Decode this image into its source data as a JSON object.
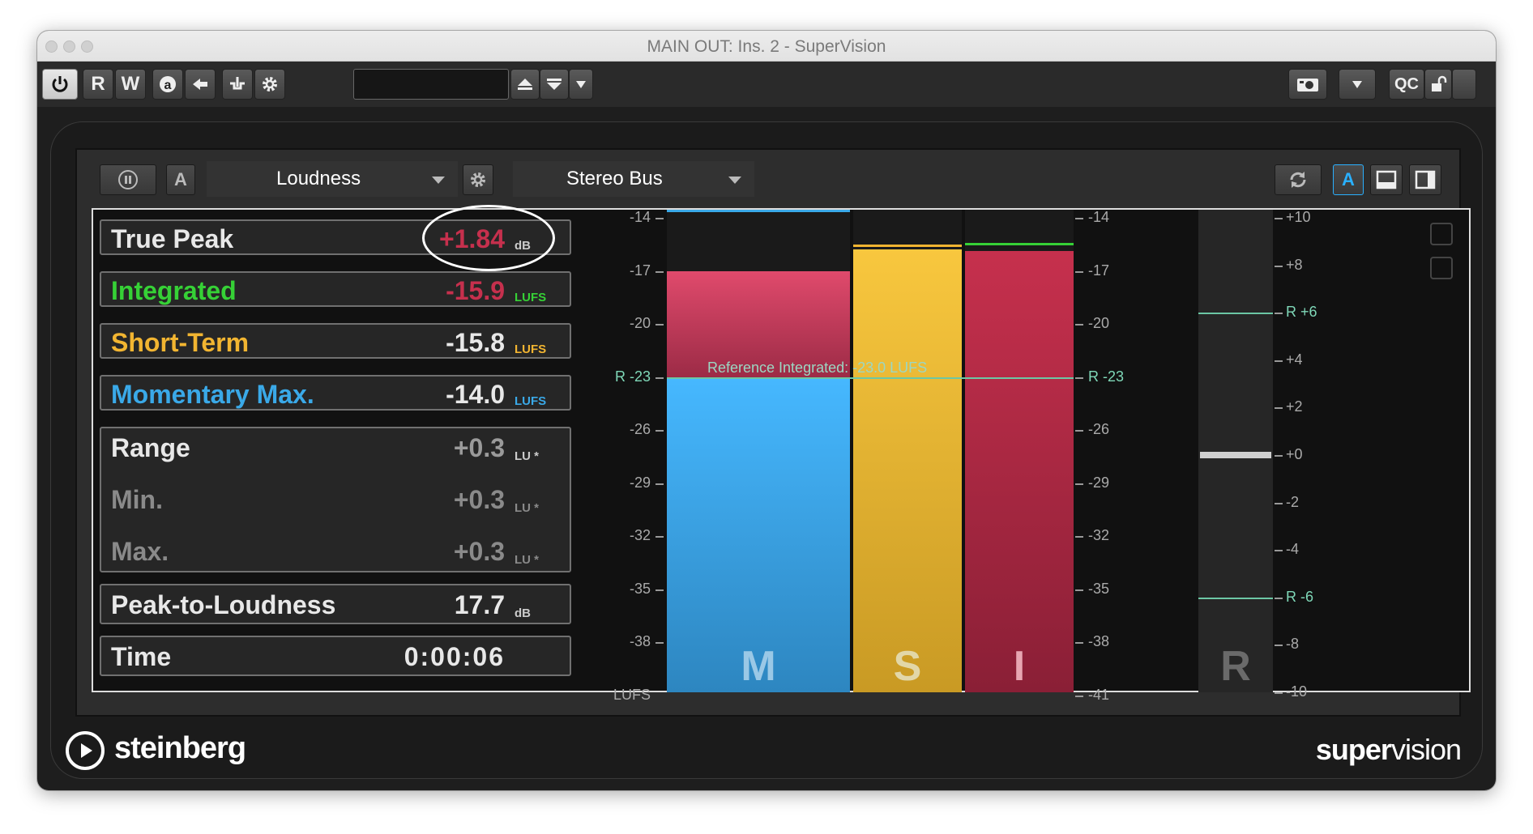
{
  "window": {
    "title": "MAIN OUT: Ins. 2 - SuperVision"
  },
  "toolbar": {
    "r": "R",
    "w": "W",
    "qc": "QC",
    "icons": [
      "power-icon",
      "read-button",
      "write-button",
      "auto-icon",
      "arrow-left-icon",
      "sidechain-icon",
      "gear-icon",
      "camera-icon",
      "lock-icon"
    ]
  },
  "header": {
    "module": "Loudness",
    "channel": "Stereo Bus",
    "a_label": "A",
    "a_right": "A"
  },
  "rows": {
    "true_peak": {
      "label": "True Peak",
      "value": "+1.84",
      "unit": "dB"
    },
    "integrated": {
      "label": "Integrated",
      "value": "-15.9",
      "unit": "LUFS"
    },
    "short_term": {
      "label": "Short-Term",
      "value": "-15.8",
      "unit": "LUFS"
    },
    "momentary": {
      "label": "Momentary Max.",
      "value": "-14.0",
      "unit": "LUFS"
    },
    "range": {
      "label": "Range",
      "value": "+0.3",
      "unit": "LU *"
    },
    "min": {
      "label": "Min.",
      "value": "+0.3",
      "unit": "LU *"
    },
    "max": {
      "label": "Max.",
      "value": "+0.3",
      "unit": "LU *"
    },
    "plr": {
      "label": "Peak-to-Loudness",
      "value": "17.7",
      "unit": "dB"
    },
    "time": {
      "label": "Time",
      "value": "0:00:06"
    }
  },
  "scale_left": [
    "-14",
    "-17",
    "-20",
    "R -23",
    "-26",
    "-29",
    "-32",
    "-35",
    "-38",
    "LUFS"
  ],
  "scale_mid": [
    "-14",
    "-17",
    "-20",
    "R -23",
    "-26",
    "-29",
    "-32",
    "-35",
    "-38",
    "-41"
  ],
  "scale_right": [
    "+10",
    "+8",
    "R +6",
    "+4",
    "+2",
    "+0",
    "-2",
    "-4",
    "R -6",
    "-8",
    "-10"
  ],
  "reference_text": "Reference Integrated: -23.0 LUFS",
  "bars": {
    "m": "M",
    "s": "S",
    "i": "I",
    "r": "R"
  },
  "bar_levels": {
    "momentary_lufs": -17.0,
    "momentary_max_lufs": -14.0,
    "short_term_lufs": -15.8,
    "integrated_lufs": -15.9,
    "range_position_lu": 0.0
  },
  "colors": {
    "momentary": "#3aa9e8",
    "short_term": "#e8b63a",
    "integrated": "#c6304d",
    "reference": "#6cc7a5"
  },
  "footer": {
    "brand": "steinberg",
    "product_a": "super",
    "product_b": "vision"
  }
}
